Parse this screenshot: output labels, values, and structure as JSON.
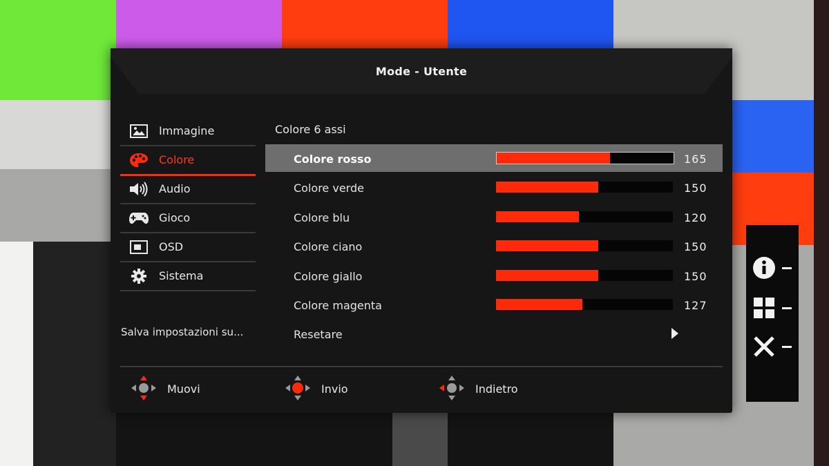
{
  "osd": {
    "title": "Mode - Utente",
    "menu": [
      {
        "label": "Immagine",
        "icon": "image-icon",
        "active": false
      },
      {
        "label": "Colore",
        "icon": "palette-icon",
        "active": true
      },
      {
        "label": "Audio",
        "icon": "speaker-icon",
        "active": false
      },
      {
        "label": "Gioco",
        "icon": "gamepad-icon",
        "active": false
      },
      {
        "label": "OSD",
        "icon": "osd-icon",
        "active": false
      },
      {
        "label": "Sistema",
        "icon": "gear-icon",
        "active": false
      }
    ],
    "save_label": "Salva impostazioni su...",
    "section_title": "Colore 6 assi",
    "rows": [
      {
        "label": "Colore rosso",
        "value": "165",
        "level": 0.64,
        "selected": true
      },
      {
        "label": "Colore verde",
        "value": "150",
        "level": 0.58,
        "selected": false
      },
      {
        "label": "Colore blu",
        "value": "120",
        "level": 0.47,
        "selected": false
      },
      {
        "label": "Colore ciano",
        "value": "150",
        "level": 0.58,
        "selected": false
      },
      {
        "label": "Colore giallo",
        "value": "150",
        "level": 0.58,
        "selected": false
      },
      {
        "label": "Colore magenta",
        "value": "127",
        "level": 0.49,
        "selected": false
      }
    ],
    "reset_label": "Resetare",
    "nav": {
      "move_label": "Muovi",
      "enter_label": "Invio",
      "back_label": "Indietro"
    },
    "accent_color": "#ff2a0a"
  },
  "side_panel": {
    "buttons": [
      {
        "icon": "info-icon"
      },
      {
        "icon": "grid-icon"
      },
      {
        "icon": "close-icon"
      }
    ]
  }
}
